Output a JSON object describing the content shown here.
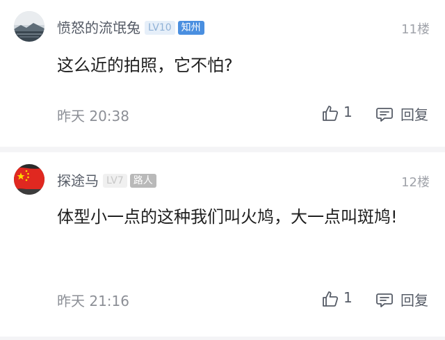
{
  "comments": [
    {
      "username": "愤怒的流氓兔",
      "level": "LV10",
      "location": "知州",
      "floor": "11楼",
      "text": "这么近的拍照，它不怕?",
      "time": "昨天 20:38",
      "likes": "1",
      "reply_label": "回复",
      "avatar_icon": "landscape-avatar-icon"
    },
    {
      "username": "探途马",
      "level": "LV7",
      "location": "路人",
      "floor": "12楼",
      "text": "体型小一点的这种我们叫火鸠，大一点叫斑鸠!",
      "time": "昨天 21:16",
      "likes": "1",
      "reply_label": "回复",
      "avatar_icon": "flag-avatar-icon"
    }
  ],
  "colors": {
    "location_badge": "#4a8fe0",
    "road_badge": "#b9b9b9",
    "text": "#1f1f1f",
    "meta": "#8c8f96"
  }
}
